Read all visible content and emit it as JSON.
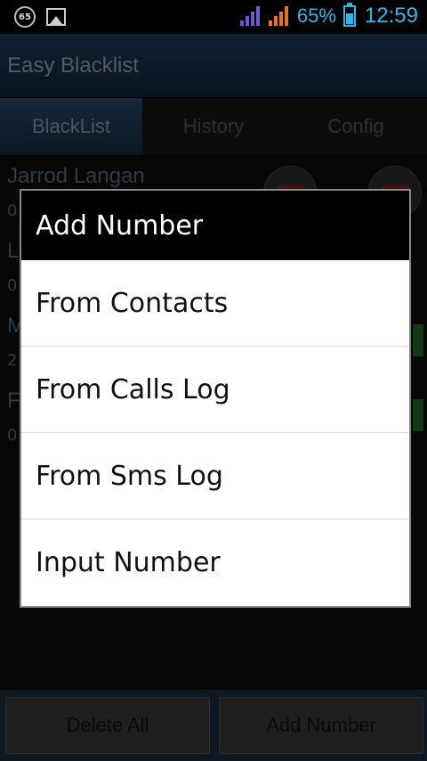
{
  "status_bar": {
    "badge": "65",
    "battery_percent": "65%",
    "time": "12:59",
    "battery_level": 0.65,
    "accent_color": "#33b5e5"
  },
  "app": {
    "title": "Easy Blacklist"
  },
  "tabs": [
    {
      "label": "BlackList",
      "active": true
    },
    {
      "label": "History",
      "active": false
    },
    {
      "label": "Config",
      "active": false
    }
  ],
  "list_background": [
    {
      "name": "Jarrod Langan",
      "number": "0"
    },
    {
      "name": "L",
      "number": "0"
    },
    {
      "name": "M",
      "number": "2"
    },
    {
      "name": "F",
      "number": "0"
    }
  ],
  "dialog": {
    "title": "Add Number",
    "options": [
      "From Contacts",
      "From Calls Log",
      "From Sms Log",
      "Input Number"
    ]
  },
  "bottom_buttons": {
    "delete_all": "Delete All",
    "add_number": "Add Number"
  }
}
